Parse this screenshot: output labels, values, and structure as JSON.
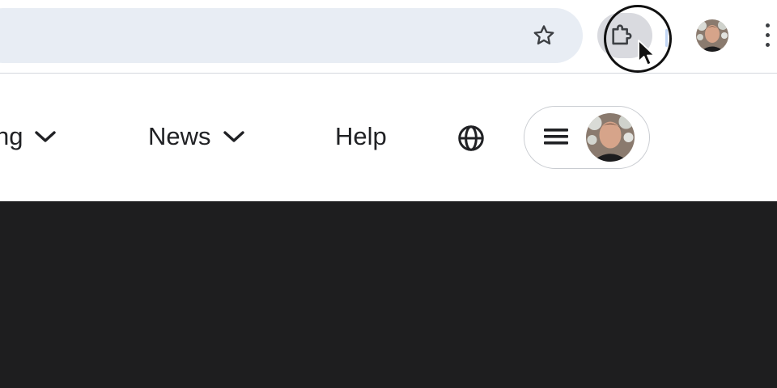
{
  "browser": {
    "bookmark_icon": "star-outline-icon",
    "extensions_icon": "puzzle-piece-icon",
    "profile_icon": "profile-avatar",
    "menu_icon": "vertical-dots-icon"
  },
  "site_nav": {
    "items": [
      {
        "label": "ng",
        "icon": "chevron-down-icon"
      },
      {
        "label": "News",
        "icon": "chevron-down-icon"
      },
      {
        "label": "Help"
      }
    ],
    "language_icon": "globe-icon",
    "account_menu_icon": "hamburger-icon"
  },
  "colors": {
    "omnibox_bg": "#e8edf4",
    "extensions_button_bg": "#d9dadf",
    "content_dark_bg": "#1e1e1f",
    "text_primary": "#202124"
  }
}
